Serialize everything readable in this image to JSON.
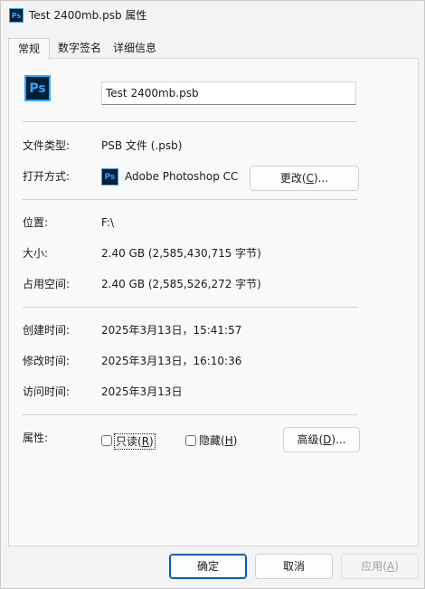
{
  "window": {
    "title": "Test 2400mb.psb 属性",
    "app_icon": "ps-icon"
  },
  "tabs": [
    {
      "label": "常规",
      "active": true
    },
    {
      "label": "数字签名",
      "active": false
    },
    {
      "label": "详细信息",
      "active": false
    }
  ],
  "general": {
    "file_icon_text": "Ps",
    "file_name": "Test 2400mb.psb",
    "file_type_label": "文件类型:",
    "file_type_value": "PSB 文件 (.psb)",
    "opens_with_label": "打开方式:",
    "opens_with_app_icon_text": "Ps",
    "opens_with_value": "Adobe Photoshop CC",
    "change_button_pre": "更改(",
    "change_button_key": "C",
    "change_button_post": ")...",
    "location_label": "位置:",
    "location_value": "F:\\",
    "size_label": "大小:",
    "size_value": "2.40 GB (2,585,430,715 字节)",
    "size_on_disk_label": "占用空间:",
    "size_on_disk_value": "2.40 GB (2,585,526,272 字节)",
    "created_label": "创建时间:",
    "created_value": "2025年3月13日，15:41:57",
    "modified_label": "修改时间:",
    "modified_value": "2025年3月13日，16:10:36",
    "accessed_label": "访问时间:",
    "accessed_value": "2025年3月13日",
    "attributes_label": "属性:",
    "readonly_pre": "只读(",
    "readonly_key": "R",
    "readonly_post": ")",
    "readonly_checked": false,
    "hidden_pre": "隐藏(",
    "hidden_key": "H",
    "hidden_post": ")",
    "hidden_checked": false,
    "advanced_pre": "高级(",
    "advanced_key": "D",
    "advanced_post": ")..."
  },
  "footer": {
    "ok_label": "确定",
    "cancel_label": "取消",
    "apply_pre": "应用(",
    "apply_key": "A",
    "apply_post": ")"
  },
  "colors": {
    "ps_background": "#001e36",
    "ps_accent": "#31a8ff",
    "primary_button_border": "#005fb8"
  }
}
